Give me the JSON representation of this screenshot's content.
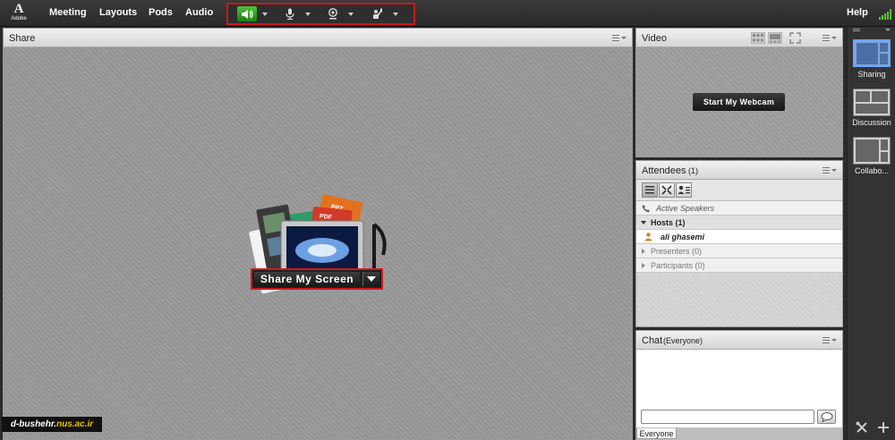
{
  "app": {
    "logo_mark": "A",
    "logo_word": "Adobe"
  },
  "menu": {
    "items": [
      "Meeting",
      "Layouts",
      "Pods",
      "Audio"
    ],
    "help": "Help"
  },
  "toolbar_controls": [
    {
      "icon": "speaker-icon",
      "active": true
    },
    {
      "icon": "microphone-icon",
      "active": false
    },
    {
      "icon": "webcam-icon",
      "active": false
    },
    {
      "icon": "raise-hand-icon",
      "active": false
    }
  ],
  "share_pod": {
    "title": "Share",
    "button_label": "Share My Screen"
  },
  "video_pod": {
    "title": "Video",
    "webcam_button": "Start My Webcam"
  },
  "attendees_pod": {
    "title": "Attendees",
    "count": "(1)",
    "active_speakers": "Active Speakers",
    "groups": [
      {
        "label": "Hosts (1)",
        "expanded": true
      },
      {
        "label": "Presenters (0)",
        "expanded": false
      },
      {
        "label": "Participants (0)",
        "expanded": false
      }
    ],
    "host_name": "ali ghasemi"
  },
  "chat_pod": {
    "title": "Chat",
    "scope": "(Everyone)",
    "tab_label": "Everyone",
    "input_value": ""
  },
  "layouts": [
    {
      "label": "Sharing",
      "active": true
    },
    {
      "label": "Discussion",
      "active": false
    },
    {
      "label": "Collabo...",
      "active": false
    }
  ],
  "watermark": {
    "prefix": "d-bushehr.",
    "domain": "nus.ac.ir"
  },
  "colors": {
    "highlight": "#cc1a1a",
    "speaker_active": "#2e9b1f",
    "signal": "#5bc236",
    "layout_active": "#6fa5ff"
  }
}
